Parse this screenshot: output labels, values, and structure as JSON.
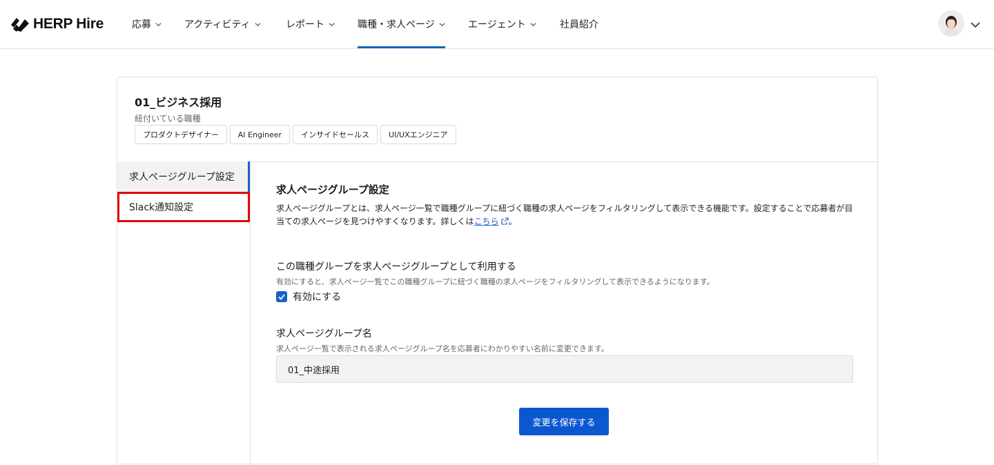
{
  "header": {
    "brand": "HERP Hire",
    "nav": [
      {
        "label": "応募",
        "has_dropdown": true
      },
      {
        "label": "アクティビティ",
        "has_dropdown": true
      },
      {
        "label": "レポート",
        "has_dropdown": true
      },
      {
        "label": "職種・求人ページ",
        "has_dropdown": true,
        "active": true
      },
      {
        "label": "エージェント",
        "has_dropdown": true
      },
      {
        "label": "社員紹介",
        "has_dropdown": false
      }
    ],
    "accent_color": "#1565c0"
  },
  "group": {
    "title": "01_ビジネス採用",
    "linked_label": "紐付いている職種",
    "linked_jobs": [
      "プロダクトデザイナー",
      "AI Engineer",
      "インサイドセールス",
      "UI/UXエンジニア"
    ]
  },
  "side_menu": {
    "items": [
      {
        "label": "求人ページグループ設定",
        "active": true
      },
      {
        "label": "Slack通知設定",
        "highlighted": true
      }
    ],
    "highlight_color": "#e00000"
  },
  "settings": {
    "title": "求人ページグループ設定",
    "description": "求人ページグループとは、求人ページ一覧で職種グループに紐づく職種の求人ページをフィルタリングして表示できる機能です。設定することで応募者が目当ての求人ページを見つけやすくなります。詳しくは",
    "link_text": "こちら",
    "description_end": "。",
    "enable_title": "この職種グループを求人ページグループとして利用する",
    "enable_help": "有効にすると、求人ページ一覧でこの職種グループに紐づく職種の求人ページをフィルタリングして表示できるようになります。",
    "checkbox_label": "有効にする",
    "checkbox_checked": true,
    "name_title": "求人ページグループ名",
    "name_help": "求人ページ一覧で表示される求人ページグループ名を応募者にわかりやすい名前に変更できます。",
    "name_value": "01_中途採用",
    "save_label": "変更を保存する",
    "button_color": "#0b57d0"
  }
}
